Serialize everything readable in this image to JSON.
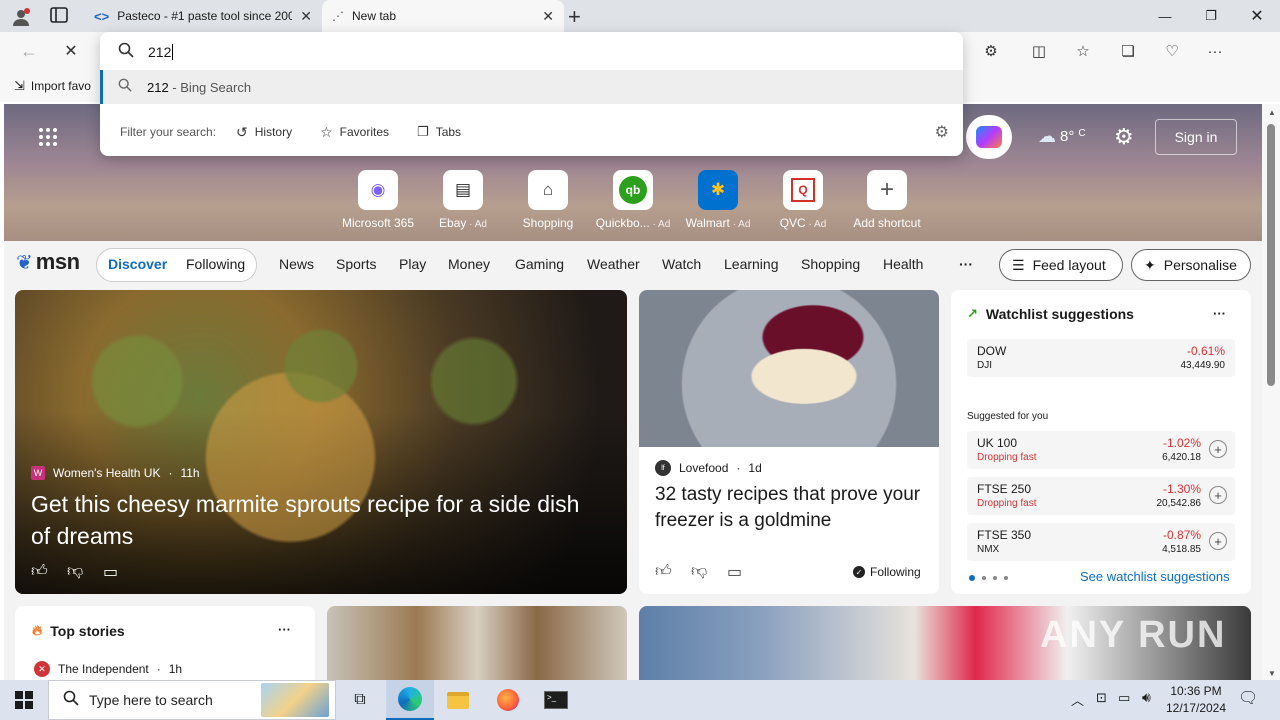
{
  "tabs": [
    {
      "title": "Pasteco - #1 paste tool since 200"
    },
    {
      "title": "New tab"
    }
  ],
  "address_bar": {
    "value": "212"
  },
  "suggestions": [
    {
      "text": "212",
      "suffix": " - Bing Search"
    }
  ],
  "filter": {
    "label": "Filter your search:",
    "options": [
      "History",
      "Favorites",
      "Tabs"
    ]
  },
  "favorites_bar": {
    "import_label": "Import favo"
  },
  "weather": {
    "temp": "8°",
    "unit": "C"
  },
  "sign_in": "Sign in",
  "shortcuts": [
    {
      "label": "Microsoft 365",
      "ad": "",
      "color": "#7b61ff"
    },
    {
      "label": "Ebay",
      "ad": " · Ad",
      "color": "#2a2a2a"
    },
    {
      "label": "Shopping",
      "ad": "",
      "color": "#333333"
    },
    {
      "label": "Quickbo...",
      "ad": " · Ad",
      "color": "#2ca01c"
    },
    {
      "label": "Walmart",
      "ad": " · Ad",
      "color": "#0071ce"
    },
    {
      "label": "QVC",
      "ad": " · Ad",
      "color": "#d1332b"
    },
    {
      "label": "Add shortcut",
      "ad": "",
      "color": "#555555"
    }
  ],
  "msn": {
    "logo": "msn",
    "discover": "Discover",
    "following": "Following",
    "nav": [
      "News",
      "Sports",
      "Play",
      "Money",
      "Gaming",
      "Weather",
      "Watch",
      "Learning",
      "Shopping",
      "Health"
    ],
    "more": "···",
    "feed_layout": "Feed layout",
    "personalise": "Personalise"
  },
  "main_article": {
    "source": "Women's Health UK",
    "age": "11h",
    "title": "Get this cheesy marmite sprouts recipe for a side dish of dreams"
  },
  "second_article": {
    "source": "Lovefood",
    "age": "1d",
    "title": "32 tasty recipes that prove your freezer is a goldmine",
    "following": "Following"
  },
  "watchlist": {
    "title": "Watchlist suggestions",
    "more": "···",
    "dow": {
      "symbol": "DOW",
      "sub": "DJI",
      "pct": "-0.61%",
      "value": "43,449.90"
    },
    "suggested_label": "Suggested for you",
    "items": [
      {
        "symbol": "UK 100",
        "note": "Dropping fast",
        "pct": "-1.02%",
        "value": "6,420.18"
      },
      {
        "symbol": "FTSE 250",
        "note": "Dropping fast",
        "pct": "-1.30%",
        "value": "20,542.86"
      },
      {
        "symbol": "FTSE 350",
        "note": "NMX",
        "pct": "-0.87%",
        "value": "4,518.85"
      }
    ],
    "see_more": "See watchlist suggestions"
  },
  "top_stories": {
    "title": "Top stories",
    "more": "···",
    "first_source": "The Independent",
    "first_age": "1h"
  },
  "watermark": "ANY RUN",
  "taskbar": {
    "search_placeholder": "Type here to search",
    "time": "10:36 PM",
    "date": "12/17/2024"
  },
  "colors": {
    "accent": "#0f6cbd",
    "negative": "#d13438",
    "msn_blue": "#2563c9"
  }
}
